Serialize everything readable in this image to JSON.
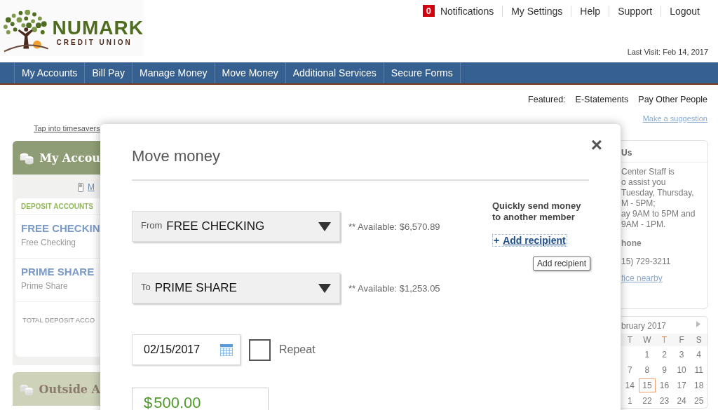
{
  "header": {
    "logo": {
      "name": "NUMARK",
      "subtitle": "CREDIT UNION"
    },
    "notifications": {
      "count": "0",
      "label": "Notifications"
    },
    "top_links": [
      "My Settings",
      "Help",
      "Support",
      "Logout"
    ],
    "last_visit": "Last Visit: Feb 14, 2017"
  },
  "nav": [
    "My Accounts",
    "Bill Pay",
    "Manage Money",
    "Move Money",
    "Additional Services",
    "Secure Forms"
  ],
  "featured": {
    "label": "Featured:",
    "links": [
      "E-Statements",
      "Pay Other People"
    ]
  },
  "suggestion_link": "Make a suggestion",
  "left": {
    "tip_link": "Tap into timesavers",
    "accounts_panel": {
      "title": "My Accou",
      "mobile_link": "M",
      "section": "DEPOSIT ACCOUNTS",
      "accounts": [
        {
          "name": "FREE CHECKIN",
          "type": "Free Checking"
        },
        {
          "name": "PRIME SHARE",
          "type": "Prime Share"
        }
      ],
      "total": "TOTAL DEPOSIT ACCO"
    },
    "outside_panel": {
      "title": "Outside A"
    }
  },
  "right": {
    "contact_panel": {
      "title": "Us",
      "lines": [
        "Center Staff is",
        "o assist you",
        "Tuesday, Thursday,",
        "M - 5PM;",
        "ay 9AM to 5PM and",
        "9AM - 1PM."
      ],
      "phone_label": "hone",
      "phone": "15) 729-3211",
      "link": "fice nearby"
    },
    "calendar": {
      "month": "bruary 2017",
      "weekdays": [
        "T",
        "W",
        "T",
        "F",
        "S"
      ],
      "weeks": [
        [
          {
            "day": "1",
            "selected": false
          },
          {
            "day": "2",
            "selected": false
          },
          {
            "day": "3",
            "selected": false
          },
          {
            "day": "4",
            "selected": false
          }
        ],
        [
          {
            "day": "7",
            "selected": false
          },
          {
            "day": "8",
            "selected": false
          },
          {
            "day": "9",
            "selected": false
          },
          {
            "day": "10",
            "selected": false
          },
          {
            "day": "11",
            "selected": false
          }
        ],
        [
          {
            "day": "14",
            "selected": false
          },
          {
            "day": "15",
            "selected": true
          },
          {
            "day": "16",
            "selected": false
          },
          {
            "day": "17",
            "selected": false
          },
          {
            "day": "18",
            "selected": false
          }
        ],
        [
          {
            "day": "1",
            "selected": false
          },
          {
            "day": "22",
            "selected": false
          },
          {
            "day": "23",
            "selected": false
          },
          {
            "day": "24",
            "selected": false
          },
          {
            "day": "25",
            "selected": false
          }
        ]
      ]
    }
  },
  "modal": {
    "title": "Move money",
    "close": "×",
    "from": {
      "prefix": "From",
      "value": "FREE CHECKING",
      "available": "** Available: $6,570.89"
    },
    "to": {
      "prefix": "To",
      "value": "PRIME SHARE",
      "available": "** Available: $1,253.05"
    },
    "date": "02/15/2017",
    "repeat": {
      "label": "Repeat",
      "checked": false
    },
    "amount": {
      "currency": "$",
      "value": "500.00"
    },
    "quick_send": {
      "heading": "Quickly send money to another member",
      "plus": "+",
      "link": "Add recipient",
      "tooltip": "Add recipient"
    }
  }
}
